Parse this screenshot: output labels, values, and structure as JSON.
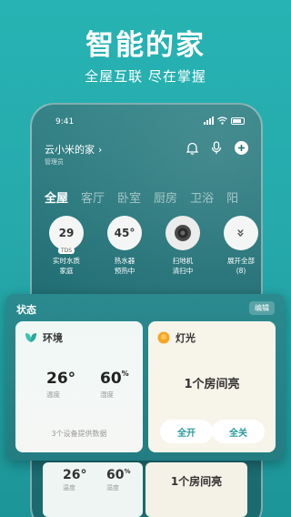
{
  "promo": {
    "title": "智能的家",
    "subtitle": "全屋互联 尽在掌握"
  },
  "status_bar": {
    "time": "9:41"
  },
  "home": {
    "name": "云小米的家",
    "chevron": "›",
    "role": "管理员"
  },
  "room_tabs": [
    "全屋",
    "客厅",
    "卧室",
    "厨房",
    "卫浴",
    "阳"
  ],
  "devices": [
    {
      "value": "29",
      "badge": "TDS",
      "label_line1": "实时水质",
      "label_line2": "家庭"
    },
    {
      "value": "45°",
      "label_line1": "热水器",
      "label_line2": "预热中"
    },
    {
      "icon": "camera-lens-icon",
      "label_line1": "扫地机",
      "label_line2": "清扫中"
    },
    {
      "icon": "double-chevron-down-icon",
      "symbol": "»",
      "label_line1": "展开全部",
      "label_line2": "(8)"
    }
  ],
  "status_panel": {
    "title": "状态",
    "edit_label": "编辑",
    "environment": {
      "title": "环境",
      "temperature": "26°",
      "temperature_label": "温度",
      "humidity": "60",
      "humidity_unit": "%",
      "humidity_label": "湿度",
      "footer": "3个设备提供数据"
    },
    "lighting": {
      "title": "灯光",
      "rooms_lit": "1个房间亮",
      "all_on_label": "全开",
      "all_off_label": "全关"
    }
  },
  "ghost_cards": {
    "temperature": "26°",
    "temperature_label": "温度",
    "humidity": "60",
    "humidity_unit": "%",
    "humidity_label": "湿度",
    "rooms_lit": "1个房间亮"
  },
  "colors": {
    "background": "#27b3b3",
    "accent": "#2a9a9c",
    "lamp": "#f5a623",
    "leaf": "#3cc2b4"
  }
}
